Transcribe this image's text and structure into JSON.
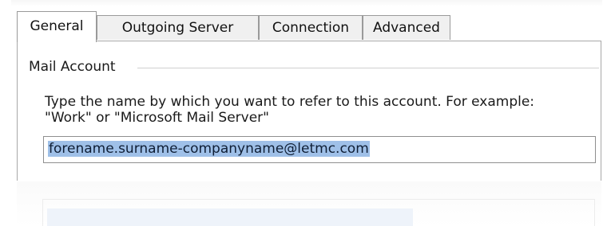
{
  "tabs": [
    {
      "label": "General",
      "active": true
    },
    {
      "label": "Outgoing Server",
      "active": false
    },
    {
      "label": "Connection",
      "active": false
    },
    {
      "label": "Advanced",
      "active": false
    }
  ],
  "group": {
    "title": "Mail Account",
    "description": "Type the name by which you want to refer to this account. For example: \"Work\" or \"Microsoft Mail Server\""
  },
  "account_name": {
    "value": "forename.surname-companyname@letmc.com"
  },
  "colors": {
    "selection": "#9fc0e8",
    "tab_border": "#9a9a9a"
  }
}
